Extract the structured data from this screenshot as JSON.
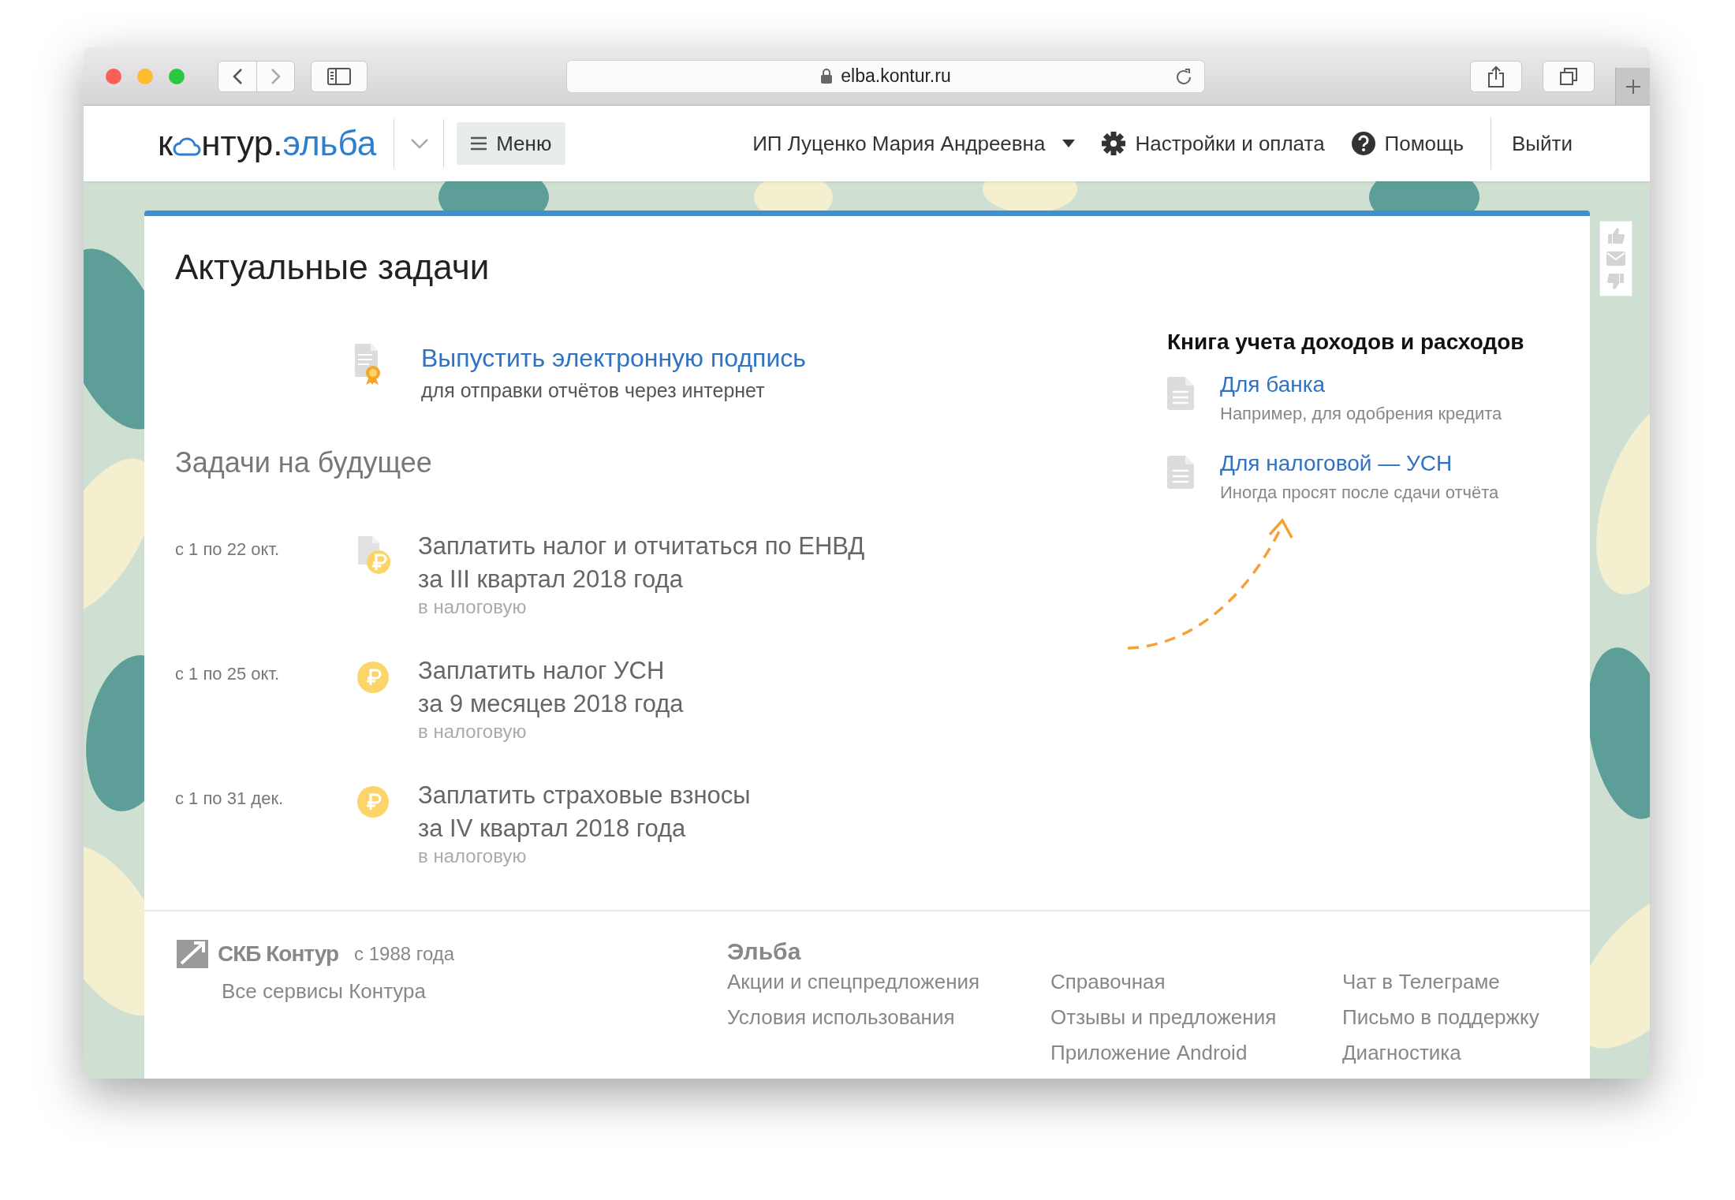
{
  "browser": {
    "url": "elba.kontur.ru"
  },
  "header": {
    "logo": {
      "prefix": "к",
      "middle": "нтур.",
      "suffix": "эльба"
    },
    "menu": "Меню",
    "user": "ИП Луценко Мария Андреевна",
    "settings": "Настройки и оплата",
    "help": "Помощь",
    "logout": "Выйти"
  },
  "main": {
    "title": "Актуальные задачи",
    "current_task": {
      "title": "Выпустить электронную подпись",
      "subtitle": "для отправки отчётов через интернет"
    },
    "future_heading": "Задачи на будущее",
    "future_tasks": [
      {
        "date": "с 1 по 22 окт.",
        "kind": "document-ruble",
        "lines": [
          "Заплатить налог и отчитаться по ЕНВД",
          "за III квартал 2018 года"
        ],
        "note": "в налоговую"
      },
      {
        "date": "с 1 по 25 окт.",
        "kind": "ruble",
        "lines": [
          "Заплатить налог УСН",
          "за 9 месяцев 2018 года"
        ],
        "note": "в налоговую"
      },
      {
        "date": "с 1 по 31 дек.",
        "kind": "ruble",
        "lines": [
          "Заплатить страховые взносы",
          "за IV квартал 2018 года"
        ],
        "note": "в налоговую"
      }
    ],
    "book": {
      "heading": "Книга учета доходов и расходов",
      "items": [
        {
          "title": "Для банка",
          "subtitle": "Например, для одобрения кредита"
        },
        {
          "title": "Для налоговой — УСН",
          "subtitle": "Иногда просят после сдачи отчёта"
        }
      ]
    }
  },
  "footer": {
    "brand": "СКБ Контур",
    "since": "с 1988 года",
    "all_services": "Все сервисы Контура",
    "section": "Эльба",
    "columns": [
      [
        "Акции и спецпредложения",
        "Условия использования"
      ],
      [
        "Справочная",
        "Отзывы и предложения",
        "Приложение Android"
      ],
      [
        "Чат в Телеграме",
        "Письмо в поддержку",
        "Диагностика"
      ]
    ]
  }
}
